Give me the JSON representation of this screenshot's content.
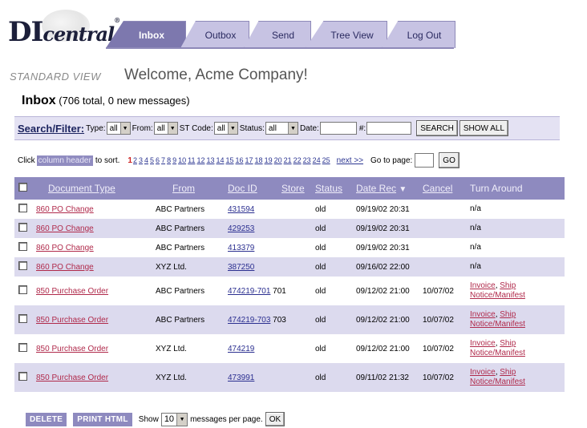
{
  "logo": {
    "di": "DI",
    "central": "central",
    "mark": "®"
  },
  "tabs": [
    {
      "label": "Inbox",
      "active": true
    },
    {
      "label": "Outbox"
    },
    {
      "label": "Send"
    },
    {
      "label": "Tree View"
    },
    {
      "label": "Log Out"
    }
  ],
  "view_label": "STANDARD VIEW",
  "welcome": "Welcome, Acme Company!",
  "inbox": {
    "title": "Inbox",
    "summary": "(706 total, 0 new messages)"
  },
  "search": {
    "title": "Search/Filter:",
    "type_label": "Type:",
    "type_value": "all",
    "from_label": "From:",
    "from_value": "all",
    "st_label": "ST Code:",
    "st_value": "all",
    "status_label": "Status:",
    "status_value": "all",
    "date_label": "Date:",
    "hash_label": "#:",
    "search_button": "SEARCH",
    "showall_button": "SHOW ALL"
  },
  "pager": {
    "click": "Click",
    "column_header": "column header",
    "to_sort": "to sort.",
    "current": "1",
    "pages": [
      "2",
      "3",
      "4",
      "5",
      "6",
      "7",
      "8",
      "9",
      "10",
      "11",
      "12",
      "13",
      "14",
      "15",
      "16",
      "17",
      "18",
      "19",
      "20",
      "21",
      "22",
      "23",
      "24",
      "25"
    ],
    "next": "next >>",
    "goto": "Go to page:",
    "go": "GO"
  },
  "table": {
    "headers": {
      "doc_type": "Document Type",
      "from": "From",
      "doc_id": "Doc ID",
      "store": "Store",
      "status": "Status",
      "date_rec": "Date Rec",
      "sort_icon": "▼",
      "cancel": "Cancel",
      "turn_around": "Turn Around"
    },
    "rows": [
      {
        "doc_type": "860 PO Change",
        "from": "ABC Partners",
        "doc_id": "431594",
        "store": "",
        "status": "old",
        "date_rec": "09/19/02 20:31",
        "cancel": "",
        "ta_text": "n/a",
        "ta_link1": "",
        "ta_comma": "",
        "ta_link2": "",
        "ta_link3": ""
      },
      {
        "doc_type": "860 PO Change",
        "from": "ABC Partners",
        "doc_id": "429253",
        "store": "",
        "status": "old",
        "date_rec": "09/19/02 20:31",
        "cancel": "",
        "ta_text": "n/a",
        "ta_link1": "",
        "ta_comma": "",
        "ta_link2": "",
        "ta_link3": ""
      },
      {
        "doc_type": "860 PO Change",
        "from": "ABC Partners",
        "doc_id": "413379",
        "store": "",
        "status": "old",
        "date_rec": "09/19/02 20:31",
        "cancel": "",
        "ta_text": "n/a",
        "ta_link1": "",
        "ta_comma": "",
        "ta_link2": "",
        "ta_link3": ""
      },
      {
        "doc_type": "860 PO Change",
        "from": "XYZ Ltd.",
        "doc_id": "387250",
        "store": "",
        "status": "old",
        "date_rec": "09/16/02 22:00",
        "cancel": "",
        "ta_text": "n/a",
        "ta_link1": "",
        "ta_comma": "",
        "ta_link2": "",
        "ta_link3": ""
      },
      {
        "doc_type": "850 Purchase Order",
        "from": "ABC Partners",
        "doc_id": "474219-701",
        "store": "701",
        "status": "old",
        "date_rec": "09/12/02 21:00",
        "cancel": "10/07/02",
        "ta_text": "",
        "ta_link1": "Invoice",
        "ta_comma": ", ",
        "ta_link2": "Ship",
        "ta_link3": "Notice/Manifest"
      },
      {
        "doc_type": "850 Purchase Order",
        "from": "ABC Partners",
        "doc_id": "474219-703",
        "store": "703",
        "status": "old",
        "date_rec": "09/12/02 21:00",
        "cancel": "10/07/02",
        "ta_text": "",
        "ta_link1": "Invoice",
        "ta_comma": ", ",
        "ta_link2": "Ship",
        "ta_link3": "Notice/Manifest"
      },
      {
        "doc_type": "850 Purchase Order",
        "from": "XYZ Ltd.",
        "doc_id": "474219",
        "store": "",
        "status": "old",
        "date_rec": "09/12/02 21:00",
        "cancel": "10/07/02",
        "ta_text": "",
        "ta_link1": "Invoice",
        "ta_comma": ", ",
        "ta_link2": "Ship",
        "ta_link3": "Notice/Manifest"
      },
      {
        "doc_type": "850 Purchase Order",
        "from": "XYZ Ltd.",
        "doc_id": "473991",
        "store": "",
        "status": "old",
        "date_rec": "09/11/02 21:32",
        "cancel": "10/07/02",
        "ta_text": "",
        "ta_link1": "Invoice",
        "ta_comma": ", ",
        "ta_link2": "Ship",
        "ta_link3": "Notice/Manifest"
      }
    ]
  },
  "bottom": {
    "delete": "DELETE",
    "print": "PRINT HTML",
    "show": "Show",
    "per_page_value": "10",
    "per_page_label": "messages per page.",
    "ok": "OK"
  },
  "colors": {
    "accent": "#8e8abf",
    "active_tab": "#7d78ae",
    "tab": "#c7c3e3",
    "row_alt": "#dcdaee",
    "link_red": "#b02a4b",
    "link_blue": "#2b2f90"
  }
}
